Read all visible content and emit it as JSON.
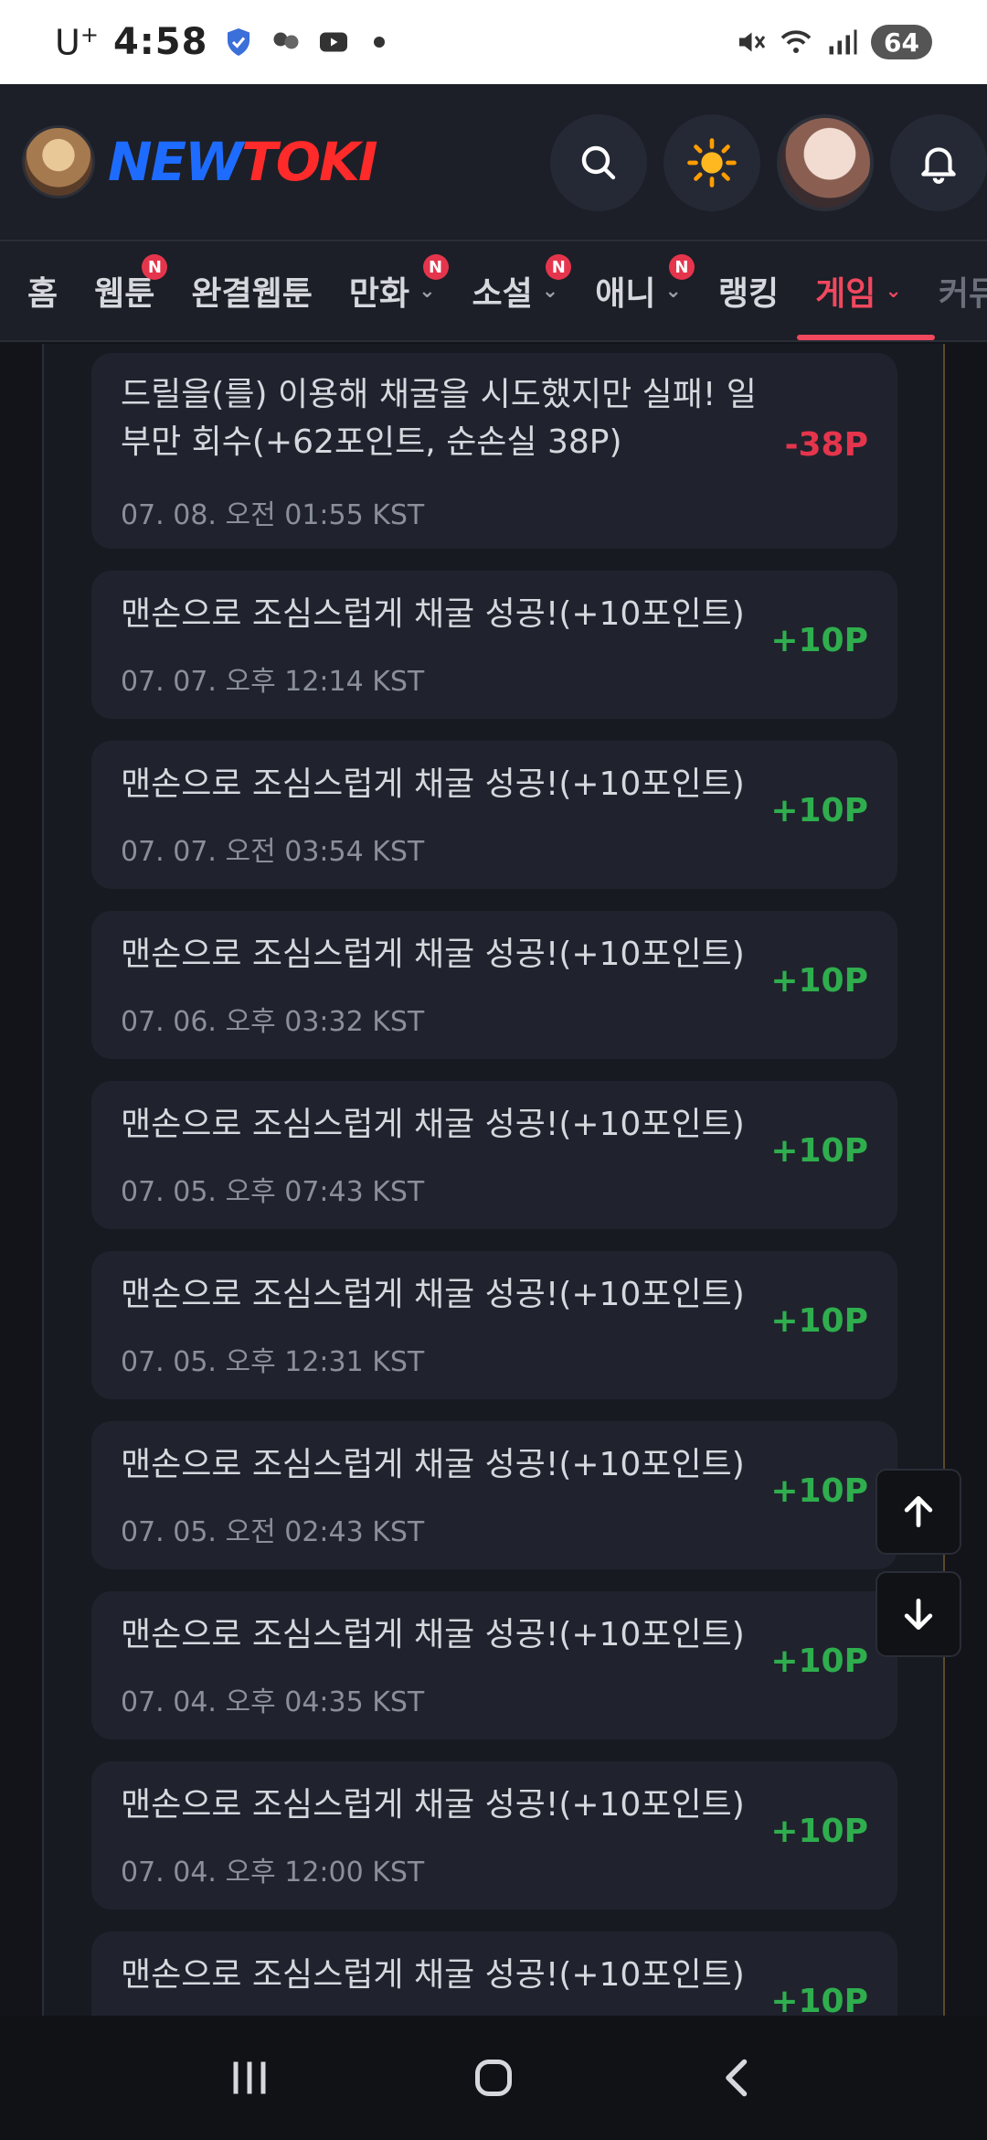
{
  "status_bar": {
    "carrier": "U",
    "carrier_sup": "+",
    "time": "4:58",
    "battery": "64"
  },
  "header": {
    "logo_part1": "NEW",
    "logo_part2": "TOKI"
  },
  "nav": {
    "tabs": [
      {
        "label": "홈",
        "badge": "",
        "chevron": false
      },
      {
        "label": "웹툰",
        "badge": "N",
        "chevron": false
      },
      {
        "label": "완결웹툰",
        "badge": "",
        "chevron": false
      },
      {
        "label": "만화",
        "badge": "N",
        "chevron": true
      },
      {
        "label": "소설",
        "badge": "N",
        "chevron": true
      },
      {
        "label": "애니",
        "badge": "N",
        "chevron": true
      },
      {
        "label": "랭킹",
        "badge": "",
        "chevron": false
      },
      {
        "label": "게임",
        "badge": "",
        "chevron": true,
        "active": true
      },
      {
        "label": "커뮤",
        "badge": "",
        "chevron": false,
        "faded": true
      }
    ]
  },
  "history": [
    {
      "text_line1": "드릴을(를) 이용해 채굴을 시도했지만 실패! 일",
      "text_line2": "부만 회수(+62포인트, 순손실 38P)",
      "date": "07. 08. 오전 01:55 KST",
      "points": "-38P",
      "negative": true
    },
    {
      "text_line1": "맨손으로 조심스럽게 채굴 성공!(+10포인트)",
      "date": "07. 07. 오후 12:14 KST",
      "points": "+10P"
    },
    {
      "text_line1": "맨손으로 조심스럽게 채굴 성공!(+10포인트)",
      "date": "07. 07. 오전 03:54 KST",
      "points": "+10P"
    },
    {
      "text_line1": "맨손으로 조심스럽게 채굴 성공!(+10포인트)",
      "date": "07. 06. 오후 03:32 KST",
      "points": "+10P"
    },
    {
      "text_line1": "맨손으로 조심스럽게 채굴 성공!(+10포인트)",
      "date": "07. 05. 오후 07:43 KST",
      "points": "+10P"
    },
    {
      "text_line1": "맨손으로 조심스럽게 채굴 성공!(+10포인트)",
      "date": "07. 05. 오후 12:31 KST",
      "points": "+10P"
    },
    {
      "text_line1": "맨손으로 조심스럽게 채굴 성공!(+10포인트)",
      "date": "07. 05. 오전 02:43 KST",
      "points": "+10P"
    },
    {
      "text_line1": "맨손으로 조심스럽게 채굴 성공!(+10포인트)",
      "date": "07. 04. 오후 04:35 KST",
      "points": "+10P"
    },
    {
      "text_line1": "맨손으로 조심스럽게 채굴 성공!(+10포인트)",
      "date": "07. 04. 오후 12:00 KST",
      "points": "+10P"
    },
    {
      "text_line1": "맨손으로 조심스럽게 채굴 성공!(+10포인트)",
      "date": "",
      "points": "+10P"
    }
  ],
  "colors": {
    "positive": "#2fae4e",
    "negative": "#e5354d",
    "accent": "#f1485f"
  }
}
